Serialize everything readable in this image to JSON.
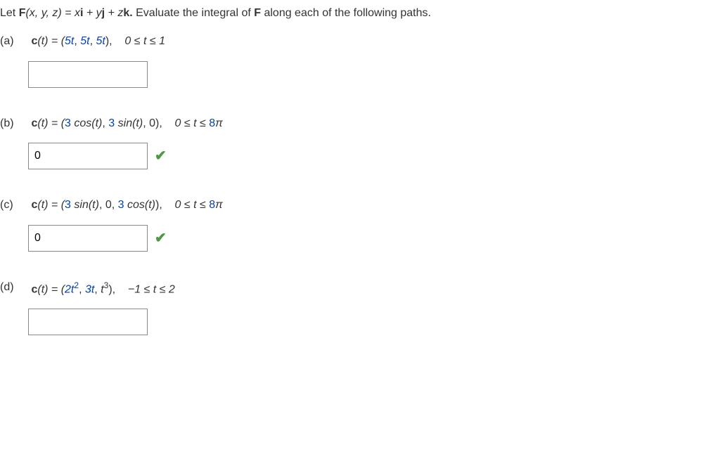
{
  "header": {
    "prefix": "Let ",
    "F": "F",
    "args": "(x, y, z) = x",
    "i": "i",
    "plus_y": " + y",
    "j": "j",
    "plus_z": " + z",
    "k": "k.",
    "suffix": " Evaluate the integral of ",
    "F2": "F",
    "tail": " along each of the following paths."
  },
  "parts": {
    "a": {
      "label": "(a)",
      "c": "c",
      "t_open": "(t) = (",
      "p1": "5t",
      "c1": ", ",
      "p2": "5t",
      "c2": ", ",
      "p3": "5t",
      "close": "),",
      "range": "0 ≤ t ≤ 1",
      "answer": ""
    },
    "b": {
      "label": "(b)",
      "c": "c",
      "t_open": "(t) = (",
      "p1": "3",
      "p1b": " cos(t)",
      "c1": ", ",
      "p2": "3",
      "p2b": " sin(t)",
      "c2": ", ",
      "p3": "0",
      "close": "),",
      "range_pre": "0 ≤ t ≤ ",
      "range_num": "8",
      "range_pi": "π",
      "answer": "0"
    },
    "c": {
      "label": "(c)",
      "c": "c",
      "t_open": "(t) = (",
      "p1": "3",
      "p1b": " sin(t)",
      "c1": ", ",
      "p2": "0",
      "c2": ", ",
      "p3": "3",
      "p3b": " cos(t)",
      "close": "),",
      "range_pre": "0 ≤ t ≤ ",
      "range_num": "8",
      "range_pi": "π",
      "answer": "0"
    },
    "d": {
      "label": "(d)",
      "c": "c",
      "t_open": "(t) = (",
      "p1": "2t",
      "p1sup": "2",
      "c1": ", ",
      "p2": "3t",
      "c2": ", ",
      "p3": "t",
      "p3sup": "3",
      "close": "),",
      "range": "−1 ≤ t ≤ 2",
      "answer": ""
    }
  }
}
